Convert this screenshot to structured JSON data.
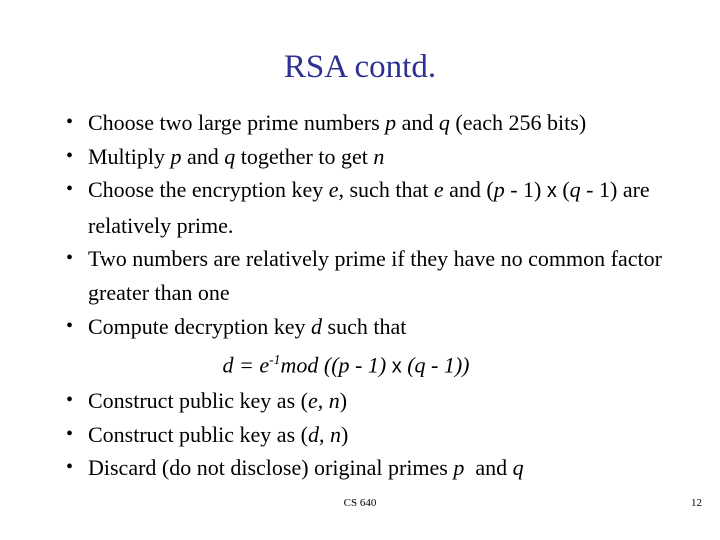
{
  "slide": {
    "title": "RSA contd.",
    "title_color": "#2E3192",
    "background_color": "#FFFFFF",
    "text_color": "#000000",
    "bullet_glyph": "•"
  },
  "bullets": [
    {
      "id": "choose-primes",
      "parts": [
        {
          "t": "Choose two large prime numbers ",
          "style": "normal"
        },
        {
          "t": "p",
          "style": "italic"
        },
        {
          "t": " and ",
          "style": "normal"
        },
        {
          "t": "q",
          "style": "italic"
        },
        {
          "t": " (each 256 bits)",
          "style": "normal"
        }
      ]
    },
    {
      "id": "multiply-pq",
      "parts": [
        {
          "t": "Multiply ",
          "style": "normal"
        },
        {
          "t": "p",
          "style": "italic"
        },
        {
          "t": " and ",
          "style": "normal"
        },
        {
          "t": "q",
          "style": "italic"
        },
        {
          "t": " together to get ",
          "style": "normal"
        },
        {
          "t": "n",
          "style": "italic"
        }
      ]
    },
    {
      "id": "choose-encryption-key",
      "parts": [
        {
          "t": "Choose the encryption key ",
          "style": "normal"
        },
        {
          "t": "e",
          "style": "italic"
        },
        {
          "t": ", such that ",
          "style": "normal"
        },
        {
          "t": "e",
          "style": "italic"
        },
        {
          "t": " and (",
          "style": "normal"
        },
        {
          "t": "p",
          "style": "italic"
        },
        {
          "t": " - 1) ",
          "style": "normal"
        },
        {
          "t": "x",
          "style": "mul"
        },
        {
          "t": " (",
          "style": "normal"
        },
        {
          "t": "q",
          "style": "italic"
        },
        {
          "t": " - 1) are relatively prime.",
          "style": "normal"
        }
      ]
    },
    {
      "id": "relatively-prime-definition",
      "parts": [
        {
          "t": "Two numbers are relatively prime if they have no common factor greater than one",
          "style": "normal"
        }
      ]
    },
    {
      "id": "compute-decryption-key",
      "parts": [
        {
          "t": "Compute decryption key ",
          "style": "normal"
        },
        {
          "t": "d",
          "style": "italic"
        },
        {
          "t": " such that",
          "style": "normal"
        }
      ]
    },
    {
      "id": "construct-public-key-en",
      "parts": [
        {
          "t": "Construct public key as (",
          "style": "normal"
        },
        {
          "t": "e",
          "style": "italic"
        },
        {
          "t": ", ",
          "style": "normal"
        },
        {
          "t": "n",
          "style": "italic"
        },
        {
          "t": ")",
          "style": "normal"
        }
      ]
    },
    {
      "id": "construct-public-key-dn",
      "parts": [
        {
          "t": "Construct public key as (",
          "style": "normal"
        },
        {
          "t": "d",
          "style": "italic"
        },
        {
          "t": ", ",
          "style": "normal"
        },
        {
          "t": "n",
          "style": "italic"
        },
        {
          "t": ")",
          "style": "normal"
        }
      ]
    },
    {
      "id": "discard-primes",
      "parts": [
        {
          "t": "Discard (do not disclose) original primes ",
          "style": "normal"
        },
        {
          "t": "p",
          "style": "italic"
        },
        {
          "t": "  and ",
          "style": "normal"
        },
        {
          "t": "q",
          "style": "italic"
        }
      ]
    }
  ],
  "formula": {
    "id": "decryption-key-formula",
    "plain": "d = e-1mod ((p - 1) x (q - 1))",
    "parts": [
      {
        "t": "d",
        "style": "italic"
      },
      {
        "t": " = ",
        "style": "italic"
      },
      {
        "t": "e",
        "style": "italic"
      },
      {
        "t": "-1",
        "style": "sup"
      },
      {
        "t": "mod",
        "style": "italic"
      },
      {
        "t": " ((",
        "style": "italic"
      },
      {
        "t": "p",
        "style": "italic"
      },
      {
        "t": " - 1) ",
        "style": "italic"
      },
      {
        "t": "x",
        "style": "mul"
      },
      {
        "t": " (",
        "style": "italic"
      },
      {
        "t": "q",
        "style": "italic"
      },
      {
        "t": " - 1))",
        "style": "italic"
      }
    ]
  },
  "footer": {
    "course": "CS 640",
    "page_number": "12"
  }
}
